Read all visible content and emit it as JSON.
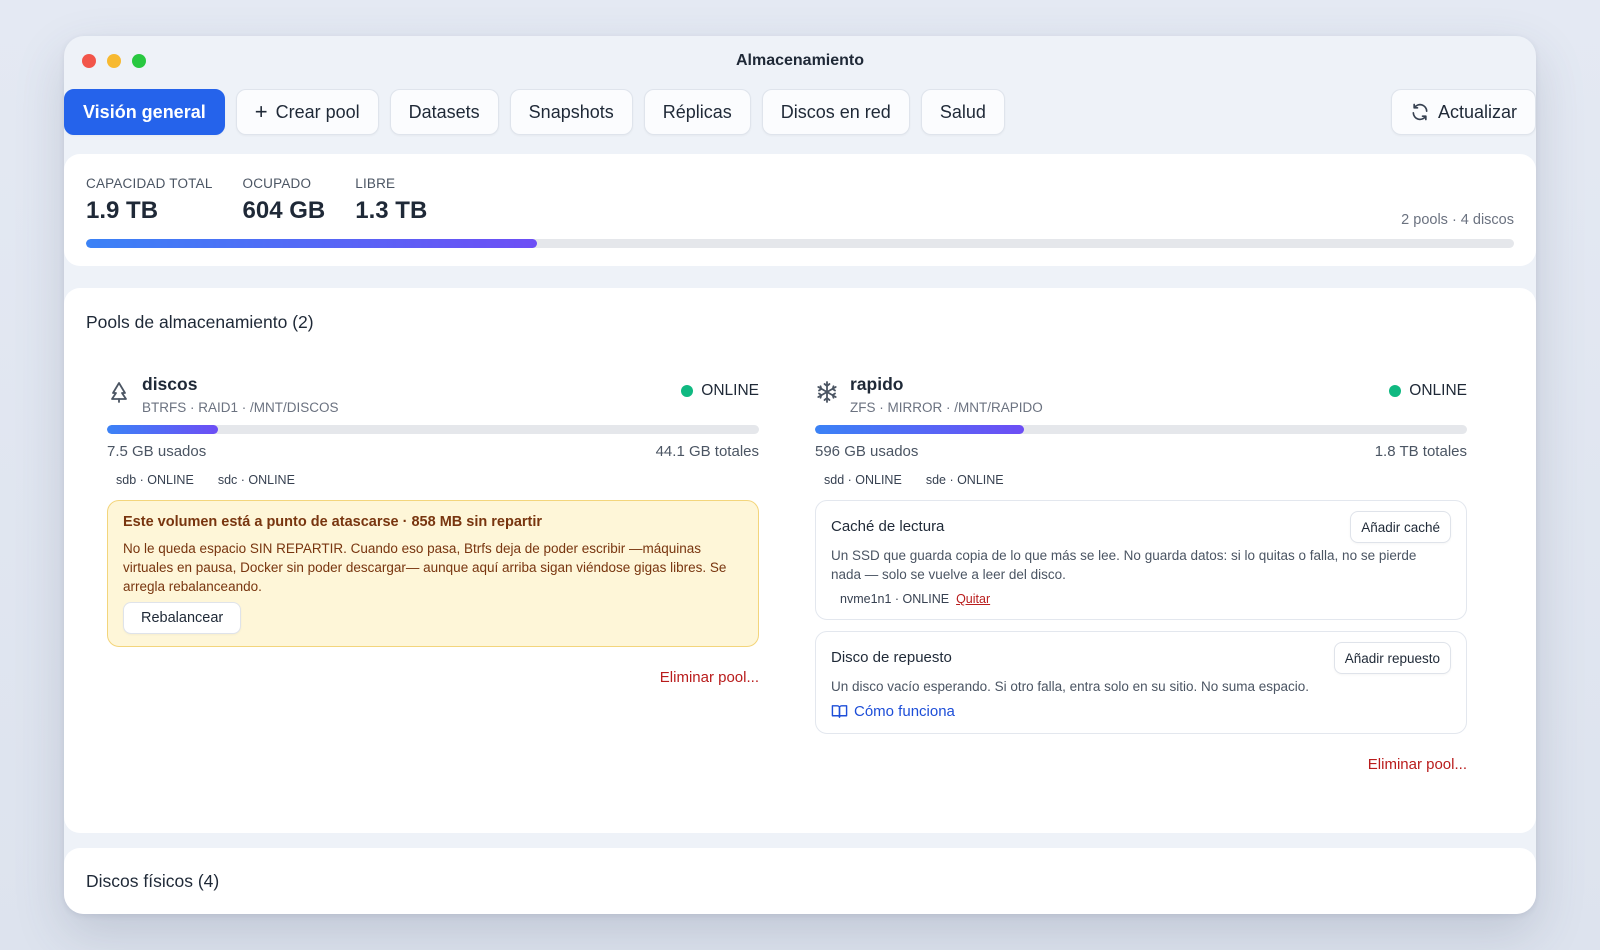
{
  "window": {
    "title": "Almacenamiento"
  },
  "tabs": [
    {
      "label": "Visión general",
      "active": true
    },
    {
      "label": "Crear pool",
      "icon": "plus-icon"
    },
    {
      "label": "Datasets"
    },
    {
      "label": "Snapshots"
    },
    {
      "label": "Réplicas"
    },
    {
      "label": "Discos en red"
    },
    {
      "label": "Salud"
    }
  ],
  "refresh": {
    "label": "Actualizar",
    "icon": "refresh-icon"
  },
  "summary": {
    "capacity_label": "CAPACIDAD TOTAL",
    "capacity_value": "1.9 TB",
    "used_label": "OCUPADO",
    "used_value": "604 GB",
    "free_label": "LIBRE",
    "free_value": "1.3 TB",
    "meta": "2 pools · 4 discos",
    "used_fraction": 0.316
  },
  "pools_section": {
    "title": "Pools de almacenamiento (2)",
    "pools": [
      {
        "name": "discos",
        "icon": "tree-icon",
        "subtitle": "BTRFS · RAID1 · /MNT/DISCOS",
        "status": "ONLINE",
        "used": "7.5 GB usados",
        "total": "44.1 GB totales",
        "used_fraction": 0.17,
        "disks": [
          "sdb · ONLINE",
          "sdc · ONLINE"
        ],
        "warning": {
          "title": "Este volumen está a punto de atascarse · 858 MB sin repartir",
          "text": "No le queda espacio SIN REPARTIR. Cuando eso pasa, Btrfs deja de poder escribir —máquinas virtuales en pausa, Docker sin poder descargar— aunque aquí arriba sigan viéndose gigas libres. Se arregla rebalanceando.",
          "button": "Rebalancear"
        },
        "delete_label": "Eliminar pool..."
      },
      {
        "name": "rapido",
        "icon": "snowflake-icon",
        "subtitle": "ZFS · MIRROR · /MNT/RAPIDO",
        "status": "ONLINE",
        "used": "596 GB usados",
        "total": "1.8 TB totales",
        "used_fraction": 0.32,
        "disks": [
          "sdd · ONLINE",
          "sde · ONLINE"
        ],
        "cache": {
          "title": "Caché de lectura",
          "button": "Añadir caché",
          "text": "Un SSD que guarda copia de lo que más se lee. No guarda datos: si lo quitas o falla, no se pierde nada — solo se vuelve a leer del disco.",
          "disk": "nvme1n1 · ONLINE",
          "remove": "Quitar"
        },
        "spare": {
          "title": "Disco de repuesto",
          "button": "Añadir repuesto",
          "text": "Un disco vacío esperando. Si otro falla, entra solo en su sitio. No suma espacio.",
          "help": "Cómo funciona",
          "help_icon": "book-icon"
        },
        "delete_label": "Eliminar pool..."
      }
    ]
  },
  "physical_section": {
    "title": "Discos físicos (4)"
  },
  "colors": {
    "accent": "#2563eb",
    "online": "#10b981",
    "danger": "#b91c1c",
    "warning_bg": "#fef6d8"
  }
}
